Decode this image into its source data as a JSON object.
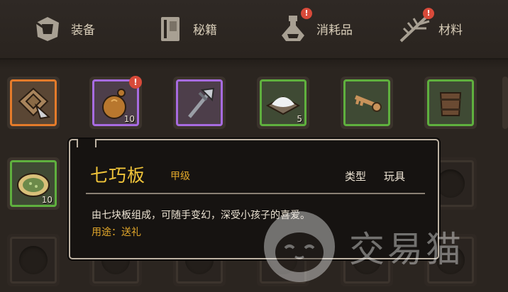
{
  "tabs": [
    {
      "label": "装备",
      "icon": "armor-icon",
      "badge": ""
    },
    {
      "label": "秘籍",
      "icon": "book-icon",
      "badge": ""
    },
    {
      "label": "消耗品",
      "icon": "potion-icon",
      "badge": "!"
    },
    {
      "label": "材料",
      "icon": "herb-icon",
      "badge": "!"
    }
  ],
  "row1": [
    {
      "icon": "tangram-board-icon",
      "rarity": "orange",
      "count": "",
      "alert": ""
    },
    {
      "icon": "gourd-icon",
      "rarity": "purple",
      "count": "10",
      "alert": "!"
    },
    {
      "icon": "axe-icon",
      "rarity": "purple",
      "count": "",
      "alert": ""
    },
    {
      "icon": "salt-pile-icon",
      "rarity": "green",
      "count": "5",
      "alert": ""
    },
    {
      "icon": "key-icon",
      "rarity": "green",
      "count": "",
      "alert": ""
    },
    {
      "icon": "wooden-bucket-icon",
      "rarity": "green",
      "count": "",
      "alert": ""
    }
  ],
  "row2": [
    {
      "icon": "herb-pancake-icon",
      "rarity": "green",
      "count": "10",
      "alert": ""
    }
  ],
  "tooltip": {
    "name": "七巧板",
    "grade": "甲级",
    "type_label": "类型",
    "type_value": "玩具",
    "description": "由七块板组成，可随手变幻，深受小孩子的喜爱。",
    "usage": "用途：送礼"
  },
  "watermark": {
    "text": "交易猫"
  },
  "colors": {
    "title": "#f0c43a",
    "grade": "#e0a62a",
    "orange": "#e47b2a",
    "purple": "#a76be0",
    "green": "#5fb03e"
  }
}
